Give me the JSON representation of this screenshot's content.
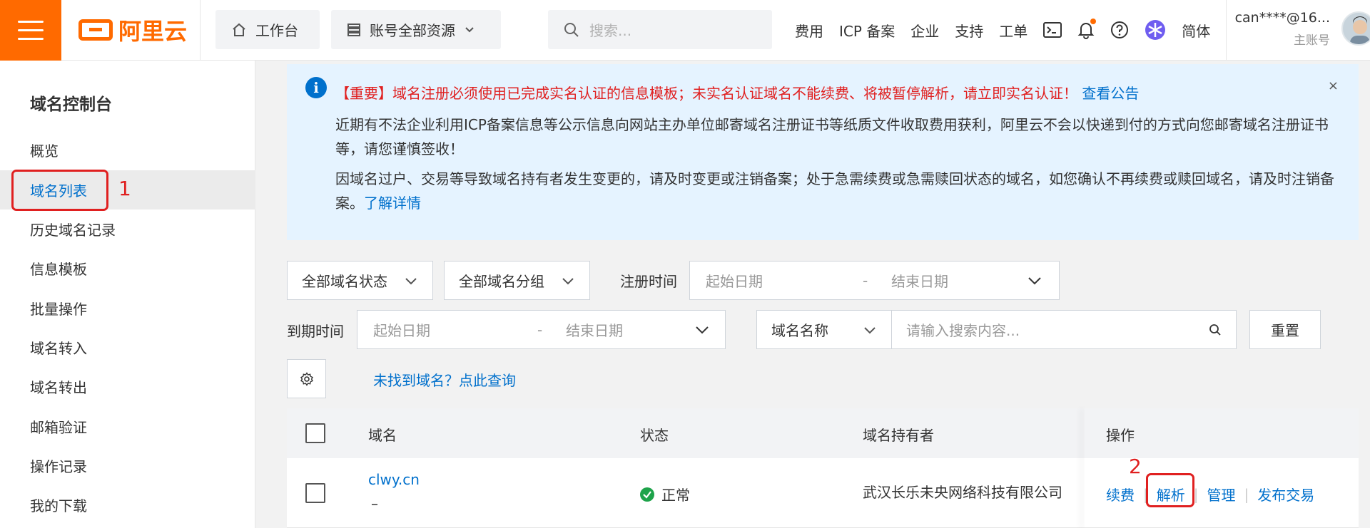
{
  "header": {
    "logo_text": "阿里云",
    "workbench": "工作台",
    "resources": "账号全部资源",
    "search_placeholder": "搜索...",
    "nav": [
      "费用",
      "ICP 备案",
      "企业",
      "支持",
      "工单"
    ],
    "lang": "简体",
    "user_name": "can****@16...",
    "user_sub": "主账号"
  },
  "sidebar": {
    "title": "域名控制台",
    "items": [
      "概览",
      "域名列表",
      "历史域名记录",
      "信息模板",
      "批量操作",
      "域名转入",
      "域名转出",
      "邮箱验证",
      "操作记录",
      "我的下载"
    ],
    "active_index": 1
  },
  "annotations": {
    "step1": "1",
    "step2": "2"
  },
  "notice": {
    "important": "【重要】域名注册必须使用已完成实名认证的信息模板；未实名认证域名不能续费、将被暂停解析，请立即实名认证！",
    "important_link": "查看公告",
    "para1": "近期有不法企业利用ICP备案信息等公示信息向网站主办单位邮寄域名注册证书等纸质文件收取费用获利，阿里云不会以快递到付的方式向您邮寄域名注册证书等，请您谨慎签收！",
    "para2": "因域名过户、交易等导致域名持有者发生变更的，请及时变更或注销备案；处于急需续费或急需赎回状态的域名，如您确认不再续费或赎回域名，请及时注销备案。",
    "para2_link": "了解详情",
    "close": "×"
  },
  "filters": {
    "status_select": "全部域名状态",
    "group_select": "全部域名分组",
    "reg_time_label": "注册时间",
    "start_date": "起始日期",
    "end_date": "结束日期",
    "range_sep": "-",
    "expire_label": "到期时间",
    "field_select": "域名名称",
    "search_placeholder": "请输入搜索内容...",
    "reset": "重置",
    "not_found_link": "未找到域名？点此查询"
  },
  "table": {
    "headers": [
      "域名",
      "状态",
      "域名持有者",
      "操作"
    ],
    "rows": [
      {
        "domain": "clwy.cn",
        "sub": "–",
        "status": "正常",
        "owner": "武汉长乐未央网络科技有限公司",
        "actions": [
          "续费",
          "解析",
          "管理",
          "发布交易"
        ]
      }
    ]
  },
  "colors": {
    "brand": "#ff6a00",
    "link": "#0070cc",
    "alert_red": "#e02020",
    "ok_green": "#1ea34a"
  }
}
